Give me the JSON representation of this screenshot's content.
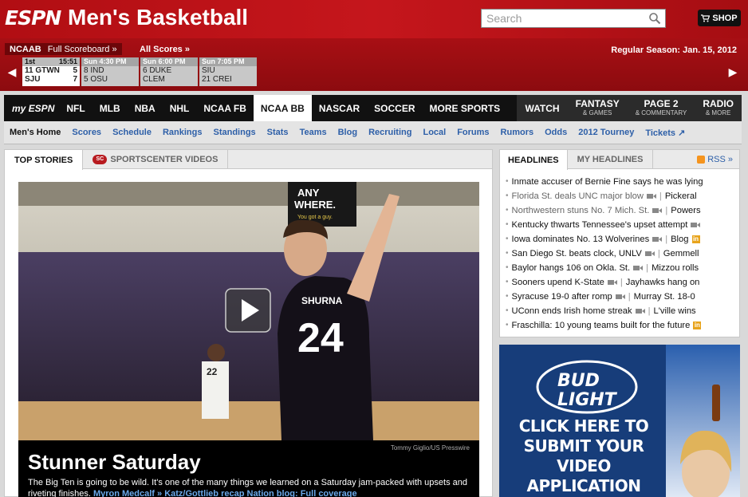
{
  "header": {
    "logo": "ESPN",
    "title": "Men's Basketball",
    "search_placeholder": "Search",
    "shop_label": "SHOP"
  },
  "scoreboard": {
    "tag": "NCAAB",
    "full_scoreboard": "Full Scoreboard »",
    "all_scores": "All Scores »",
    "season": "Regular Season: Jan. 15, 2012",
    "games": [
      {
        "status": "1st",
        "time": "15:51",
        "team1": "11 GTWN",
        "score1": "5",
        "team2": "SJU",
        "score2": "7",
        "live": true
      },
      {
        "status": "Sun 4:30 PM",
        "time": "",
        "team1": "8 IND",
        "score1": "",
        "team2": "5 OSU",
        "score2": "",
        "live": false
      },
      {
        "status": "Sun 6:00 PM",
        "time": "",
        "team1": "6 DUKE",
        "score1": "",
        "team2": "CLEM",
        "score2": "",
        "live": false
      },
      {
        "status": "Sun 7:05 PM",
        "time": "",
        "team1": "SIU",
        "score1": "",
        "team2": "21 CREI",
        "score2": "",
        "live": false
      }
    ]
  },
  "mainnav": {
    "myespn": "my ESPN",
    "items": [
      "NFL",
      "MLB",
      "NBA",
      "NHL",
      "NCAA FB",
      "NCAA BB",
      "NASCAR",
      "SOCCER",
      "MORE SPORTS"
    ],
    "watch": "WATCH",
    "fantasy": "FANTASY",
    "fantasy_sub": "& GAMES",
    "page2": "PAGE 2",
    "page2_sub": "& COMMENTARY",
    "radio": "RADIO",
    "radio_sub": "& MORE"
  },
  "subnav": {
    "items": [
      "Men's Home",
      "Scores",
      "Schedule",
      "Rankings",
      "Standings",
      "Stats",
      "Teams",
      "Blog",
      "Recruiting",
      "Local",
      "Forums",
      "Rumors",
      "Odds",
      "2012 Tourney",
      "Tickets"
    ]
  },
  "stories": {
    "tab1": "TOP STORIES",
    "tab2": "SPORTSCENTER VIDEOS",
    "sign_line1": "ANY",
    "sign_line2": "WHERE.",
    "sign_line3": "You got a guy.",
    "jersey_name": "SHURNA",
    "jersey_number": "24",
    "opponent_number": "22",
    "credit": "Tommy Giglio/US Presswire",
    "headline": "Stunner Saturday",
    "blurb": "The Big Ten is going to be wild. It's one of the many things we learned on a Saturday jam-packed with upsets and riveting finishes.",
    "link1": "Myron Medcalf »",
    "link2": "Katz/Gottlieb recap",
    "link3": "Nation blog: Full coverage"
  },
  "headlines": {
    "tab1": "HEADLINES",
    "tab2": "MY HEADLINES",
    "rss": "RSS »",
    "items": [
      {
        "text": "Inmate accuser of Bernie Fine says he was lying",
        "video": false,
        "extra": "",
        "blog": false,
        "visited": false
      },
      {
        "text": "Florida St. deals UNC major blow",
        "video": true,
        "extra": "Pickeral",
        "blog": false,
        "visited": true
      },
      {
        "text": "Northwestern stuns No. 7 Mich. St.",
        "video": true,
        "extra": "Powers",
        "blog": false,
        "visited": true
      },
      {
        "text": "Kentucky thwarts Tennessee's upset attempt",
        "video": true,
        "extra": "",
        "blog": false,
        "visited": false
      },
      {
        "text": "Iowa dominates No. 13 Wolverines",
        "video": true,
        "extra": "Blog",
        "blog": true,
        "visited": false
      },
      {
        "text": "San Diego St. beats clock, UNLV",
        "video": true,
        "extra": "Gemmell",
        "blog": false,
        "visited": false
      },
      {
        "text": "Baylor hangs 106 on Okla. St.",
        "video": true,
        "extra": "Mizzou rolls",
        "blog": false,
        "visited": false
      },
      {
        "text": "Sooners upend K-State",
        "video": true,
        "extra": "Jayhawks hang on",
        "blog": false,
        "visited": false
      },
      {
        "text": "Syracuse 19-0 after romp",
        "video": true,
        "extra": "Murray St. 18-0",
        "blog": false,
        "visited": false
      },
      {
        "text": "UConn ends Irish home streak",
        "video": true,
        "extra": "L'ville wins",
        "blog": false,
        "visited": false
      },
      {
        "text": "Fraschilla: 10 young teams built for the future",
        "video": false,
        "extra": "",
        "blog": true,
        "visited": false
      }
    ]
  },
  "ad": {
    "brand_line1": "BUD",
    "brand_line2": "LIGHT",
    "text": "CLICK HERE TO SUBMIT YOUR VIDEO APPLICATION TODAY"
  },
  "colors": {
    "espn_red": "#c5161c",
    "nav_black": "#111111",
    "link_blue": "#2d5fa8",
    "ad_blue": "#173d7a"
  }
}
